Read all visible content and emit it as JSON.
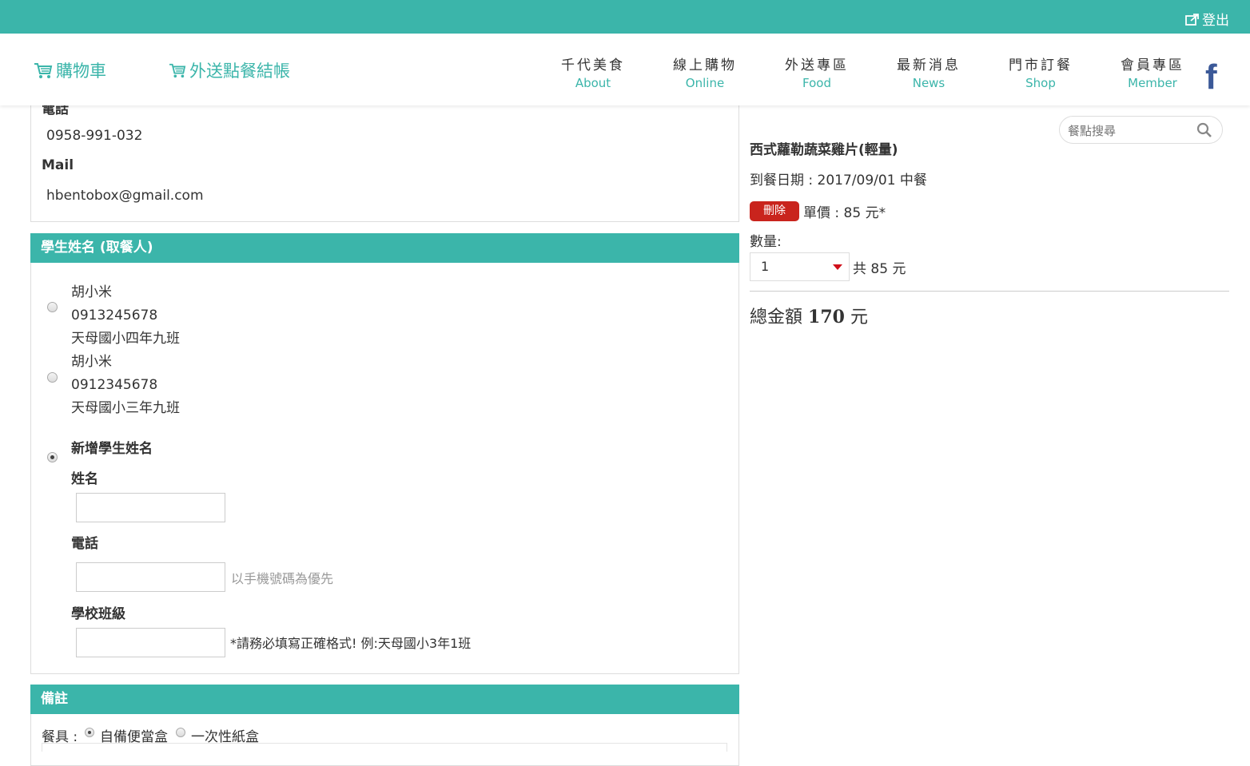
{
  "topbar": {
    "logout_label": "登出"
  },
  "header": {
    "cart_label": "購物車",
    "delivery_checkout_label": "外送點餐結帳",
    "nav": [
      {
        "zh": "千代美食",
        "en": "About"
      },
      {
        "zh": "線上購物",
        "en": "Online"
      },
      {
        "zh": "外送專區",
        "en": "Food"
      },
      {
        "zh": "最新消息",
        "en": "News"
      },
      {
        "zh": "門市訂餐",
        "en": "Shop"
      },
      {
        "zh": "會員專區",
        "en": "Member"
      }
    ],
    "facebook_label": "f"
  },
  "contact": {
    "phone_label": "電話",
    "phone_value": "0958-991-032",
    "mail_label": "Mail",
    "mail_value": "hbentobox@gmail.com"
  },
  "student_section": {
    "title": "學生姓名 (取餐人)",
    "options": [
      {
        "name": "胡小米",
        "phone": "0913245678",
        "class": "天母國小四年九班",
        "selected": false
      },
      {
        "name": "胡小米",
        "phone": "0912345678",
        "class": "天母國小三年九班",
        "selected": false
      }
    ],
    "new_student_label": "新增學生姓名",
    "new_selected": true,
    "name_label": "姓名",
    "phone_label": "電話",
    "phone_hint": "以手機號碼為優先",
    "class_label": "學校班級",
    "class_hint": "*請務必填寫正確格式! 例:天母國小3年1班"
  },
  "remarks": {
    "title": "備註",
    "utensil_label": "餐具 :",
    "utensil_options": [
      "自備便當盒",
      "一次性紙盒"
    ],
    "utensil_selected": "自備便當盒"
  },
  "cart": {
    "search_placeholder": "餐點搜尋",
    "item_name": "西式蘿勒蔬菜雞片(輕量)",
    "date_line": "到餐日期 : 2017/09/01 中餐",
    "delete_label": "刪除",
    "unit_price": "單價 : 85 元*",
    "qty_label": "數量:",
    "qty_value": "1",
    "subtotal": "共 85 元",
    "total_label": "總金額",
    "total_value": "170",
    "total_unit": "元"
  },
  "colors": {
    "brand": "#3bb5aa",
    "danger": "#c9241d",
    "facebook": "#3b5998"
  }
}
